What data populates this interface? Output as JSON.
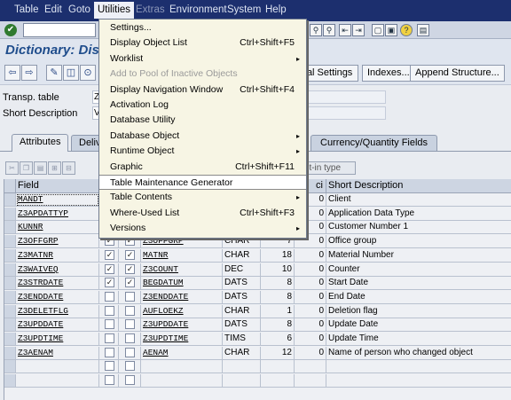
{
  "menu_bar": {
    "items": [
      {
        "label": "Table",
        "state": "normal"
      },
      {
        "label": "Edit",
        "state": "normal"
      },
      {
        "label": "Goto",
        "state": "normal"
      },
      {
        "label": "Utilities",
        "state": "active"
      },
      {
        "label": "Extras",
        "state": "disabled"
      },
      {
        "label": "Environment",
        "state": "normal"
      },
      {
        "label": "System",
        "state": "normal"
      },
      {
        "label": "Help",
        "state": "normal"
      }
    ]
  },
  "system_toolbar": {
    "ok_icon": "enter-checkmark-icon",
    "command_field_value": ""
  },
  "title": "Dictionary: Disp",
  "app_toolbar": {
    "buttons": [
      "Technical Settings",
      "Indexes...",
      "Append Structure..."
    ],
    "visible_fragment": "ical Settings"
  },
  "header": {
    "table_label": "Transp. table",
    "short_desc_label": "Short Description",
    "table_value_fragment": "Z",
    "short_desc_value_fragment": "V"
  },
  "tabs": [
    {
      "label": "Attributes",
      "selected": true
    },
    {
      "label": "Deliv",
      "selected": false
    },
    {
      "label": "Currency/Quantity Fields",
      "selected": false
    }
  ],
  "table_toolbar": {
    "builtin_label": "ilt-in type"
  },
  "grid": {
    "headers": {
      "field": "Field",
      "deci": "ci",
      "short_desc": "Short Description"
    },
    "rows": [
      {
        "field": "MANDT",
        "key": "",
        "init": "",
        "element": "",
        "type": "",
        "length": "",
        "dec": "0",
        "desc": "Client",
        "first": true
      },
      {
        "field": "Z3APDATTYP",
        "key": "",
        "init": "",
        "element": "",
        "type": "",
        "length": "",
        "dec": "0",
        "desc": "Application Data Type"
      },
      {
        "field": "KUNNR",
        "key": "",
        "init": "",
        "element": "",
        "type": "",
        "length": "",
        "dec": "0",
        "desc": "Customer Number 1"
      },
      {
        "field": "Z3OFFGRP",
        "key": "✓",
        "init": "✓",
        "element": "Z3OFFGRP",
        "type": "CHAR",
        "length": "7",
        "dec": "0",
        "desc": "Office group"
      },
      {
        "field": "Z3MATNR",
        "key": "✓",
        "init": "✓",
        "element": "MATNR",
        "type": "CHAR",
        "length": "18",
        "dec": "0",
        "desc": "Material Number"
      },
      {
        "field": "Z3WAIVEQ",
        "key": "✓",
        "init": "✓",
        "element": "Z3COUNT",
        "type": "DEC",
        "length": "10",
        "dec": "0",
        "desc": "Counter"
      },
      {
        "field": "Z3STRDATE",
        "key": "✓",
        "init": "✓",
        "element": "BEGDATUM",
        "type": "DATS",
        "length": "8",
        "dec": "0",
        "desc": "Start Date"
      },
      {
        "field": "Z3ENDDATE",
        "key": "",
        "init": "",
        "element": "Z3ENDDATE",
        "type": "DATS",
        "length": "8",
        "dec": "0",
        "desc": "End Date"
      },
      {
        "field": "Z3DELETFLG",
        "key": "",
        "init": "",
        "element": "AUFLOEKZ",
        "type": "CHAR",
        "length": "1",
        "dec": "0",
        "desc": "Deletion flag"
      },
      {
        "field": "Z3UPDDATE",
        "key": "",
        "init": "",
        "element": "Z3UPDDATE",
        "type": "DATS",
        "length": "8",
        "dec": "0",
        "desc": "Update Date"
      },
      {
        "field": "Z3UPDTIME",
        "key": "",
        "init": "",
        "element": "Z3UPDTIME",
        "type": "TIMS",
        "length": "6",
        "dec": "0",
        "desc": "Update Time"
      },
      {
        "field": "Z3AENAM",
        "key": "",
        "init": "",
        "element": "AENAM",
        "type": "CHAR",
        "length": "12",
        "dec": "0",
        "desc": "Name of person who changed object"
      },
      {
        "field": "",
        "key": "",
        "init": "",
        "element": "",
        "type": "",
        "length": "",
        "dec": "",
        "desc": ""
      },
      {
        "field": "",
        "key": "",
        "init": "",
        "element": "",
        "type": "",
        "length": "",
        "dec": "",
        "desc": ""
      }
    ]
  },
  "utilities_menu": {
    "items": [
      {
        "label": "Settings...",
        "shortcut": "",
        "submenu": false,
        "disabled": false
      },
      {
        "label": "Display Object List",
        "shortcut": "Ctrl+Shift+F5",
        "submenu": false,
        "disabled": false
      },
      {
        "label": "Worklist",
        "shortcut": "",
        "submenu": true,
        "disabled": false
      },
      {
        "label": "Add to Pool of Inactive Objects",
        "shortcut": "",
        "submenu": false,
        "disabled": true
      },
      {
        "label": "Display Navigation Window",
        "shortcut": "Ctrl+Shift+F4",
        "submenu": false,
        "disabled": false
      },
      {
        "label": "Activation Log",
        "shortcut": "",
        "submenu": false,
        "disabled": false
      },
      {
        "label": "Database Utility",
        "shortcut": "",
        "submenu": false,
        "disabled": false
      },
      {
        "label": "Database Object",
        "shortcut": "",
        "submenu": true,
        "disabled": false
      },
      {
        "label": "Runtime Object",
        "shortcut": "",
        "submenu": true,
        "disabled": false
      },
      {
        "label": "Graphic",
        "shortcut": "Ctrl+Shift+F11",
        "submenu": false,
        "disabled": false
      },
      {
        "label": "Table Maintenance Generator",
        "shortcut": "",
        "submenu": false,
        "disabled": false,
        "highlighted": true
      },
      {
        "label": "Table Contents",
        "shortcut": "",
        "submenu": true,
        "disabled": false
      },
      {
        "label": "Where-Used List",
        "shortcut": "Ctrl+Shift+F3",
        "submenu": false,
        "disabled": false
      },
      {
        "label": "Versions",
        "shortcut": "",
        "submenu": true,
        "disabled": false
      }
    ]
  },
  "colors": {
    "menubar_bg": "#1c2f6e",
    "title_color": "#1f4d8c",
    "dropdown_bg": "#f7f5e4"
  }
}
